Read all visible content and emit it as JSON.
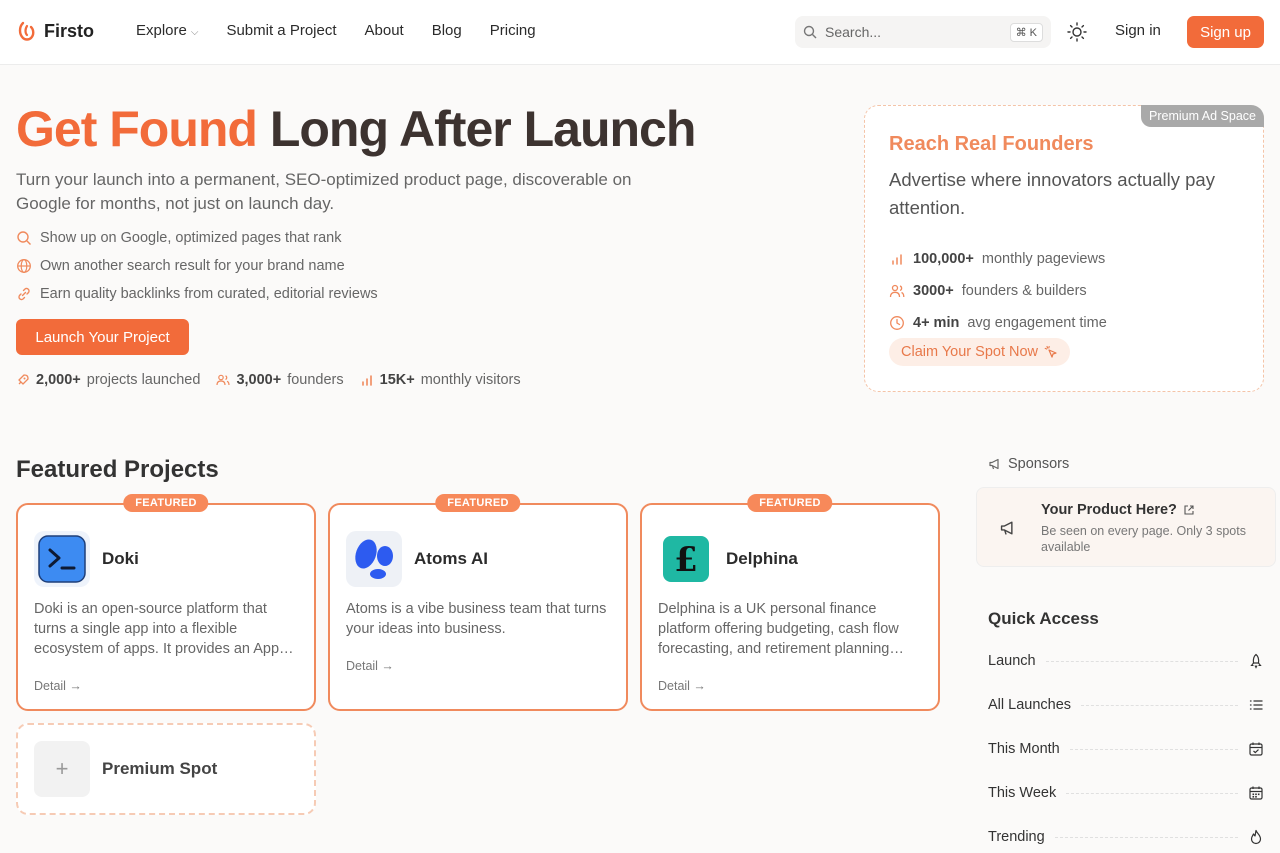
{
  "nav": {
    "brand": "Firsto",
    "links": [
      "Explore",
      "Submit a Project",
      "About",
      "Blog",
      "Pricing"
    ],
    "search_placeholder": "Search...",
    "search_shortcut": "⌘ K",
    "signin": "Sign in",
    "signup": "Sign up"
  },
  "hero": {
    "title_accent": "Get Found",
    "title_rest": " Long After Launch",
    "subtitle": "Turn your launch into a permanent, SEO-optimized product page, discoverable on Google for months, not just on launch day.",
    "bullets": [
      "Show up on Google, optimized pages that rank",
      "Own another search result for your brand name",
      "Earn quality backlinks from curated, editorial reviews"
    ],
    "cta": "Launch Your Project",
    "stats": [
      {
        "value": "2,000+",
        "label": "projects launched"
      },
      {
        "value": "3,000+",
        "label": "founders"
      },
      {
        "value": "15K+",
        "label": "monthly visitors"
      }
    ]
  },
  "ad": {
    "badge": "Premium Ad Space",
    "title": "Reach Real Founders",
    "desc": "Advertise where innovators actually pay attention.",
    "rows": [
      {
        "value": "100,000+",
        "label": "monthly pageviews"
      },
      {
        "value": "3000+",
        "label": "founders & builders"
      },
      {
        "value": "4+ min",
        "label": "avg engagement time"
      }
    ],
    "claim": "Claim Your Spot Now"
  },
  "featured": {
    "heading": "Featured Projects",
    "badge": "FEATURED",
    "detail": "Detail →",
    "projects": [
      {
        "name": "Doki",
        "desc": "Doki is an open-source platform that turns a single app into a flexible ecosystem of apps. It provides an App Store and plugin system for developers."
      },
      {
        "name": "Atoms AI",
        "desc": "Atoms is a vibe business team that turns your ideas into business."
      },
      {
        "name": "Delphina",
        "desc": "Delphina is a UK personal finance platform offering budgeting, cash flow forecasting, and retirement planning tools."
      }
    ],
    "premium": "Premium Spot"
  },
  "sidebar": {
    "sponsors": "Sponsors",
    "sponsor_title": "Your Product Here?",
    "sponsor_sub": "Be seen on every page. Only 3 spots available",
    "quick_access": "Quick Access",
    "items": [
      "Launch",
      "All Launches",
      "This Month",
      "This Week",
      "Trending"
    ]
  },
  "colors": {
    "accent": "#f26b3a",
    "accent_soft": "#f08a5d"
  }
}
